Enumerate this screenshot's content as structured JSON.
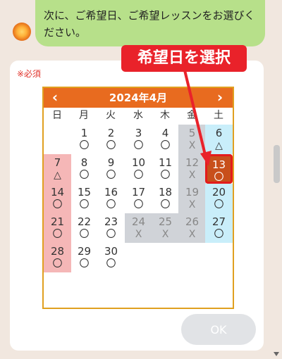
{
  "chat": {
    "message": "次に、ご希望日、ご希望レッスンをお選びください。"
  },
  "form": {
    "required_label": "※必須",
    "ok_label": "OK"
  },
  "calendar": {
    "title": "2024年4月",
    "prev": "‹",
    "next": "›",
    "weekdays": [
      "日",
      "月",
      "火",
      "水",
      "木",
      "金",
      "土"
    ],
    "weeks": [
      [
        null,
        {
          "d": "1",
          "m": "〇"
        },
        {
          "d": "2",
          "m": "〇"
        },
        {
          "d": "3",
          "m": "〇"
        },
        {
          "d": "4",
          "m": "〇"
        },
        {
          "d": "5",
          "m": "X"
        },
        {
          "d": "6",
          "m": "△"
        }
      ],
      [
        {
          "d": "7",
          "m": "△"
        },
        {
          "d": "8",
          "m": "〇"
        },
        {
          "d": "9",
          "m": "〇"
        },
        {
          "d": "10",
          "m": "〇"
        },
        {
          "d": "11",
          "m": "〇"
        },
        {
          "d": "12",
          "m": "X"
        },
        {
          "d": "13",
          "m": "〇"
        }
      ],
      [
        {
          "d": "14",
          "m": "〇"
        },
        {
          "d": "15",
          "m": "〇"
        },
        {
          "d": "16",
          "m": "〇"
        },
        {
          "d": "17",
          "m": "〇"
        },
        {
          "d": "18",
          "m": "〇"
        },
        {
          "d": "19",
          "m": "X"
        },
        {
          "d": "20",
          "m": "〇"
        }
      ],
      [
        {
          "d": "21",
          "m": "〇"
        },
        {
          "d": "22",
          "m": "〇"
        },
        {
          "d": "23",
          "m": "〇"
        },
        {
          "d": "24",
          "m": "X"
        },
        {
          "d": "25",
          "m": "X"
        },
        {
          "d": "26",
          "m": "X"
        },
        {
          "d": "27",
          "m": "〇"
        }
      ],
      [
        {
          "d": "28",
          "m": "〇"
        },
        {
          "d": "29",
          "m": "〇"
        },
        {
          "d": "30",
          "m": "〇"
        },
        null,
        null,
        null,
        null
      ]
    ],
    "selected_day": "13"
  },
  "annotation": {
    "label": "希望日を選択"
  },
  "colors": {
    "header": "#e86b1f",
    "sunday": "#f5b7b7",
    "saturday": "#c9eefa",
    "closed": "#d0d3d8",
    "selected": "#c84f1b",
    "annotation": "#e9222a"
  }
}
